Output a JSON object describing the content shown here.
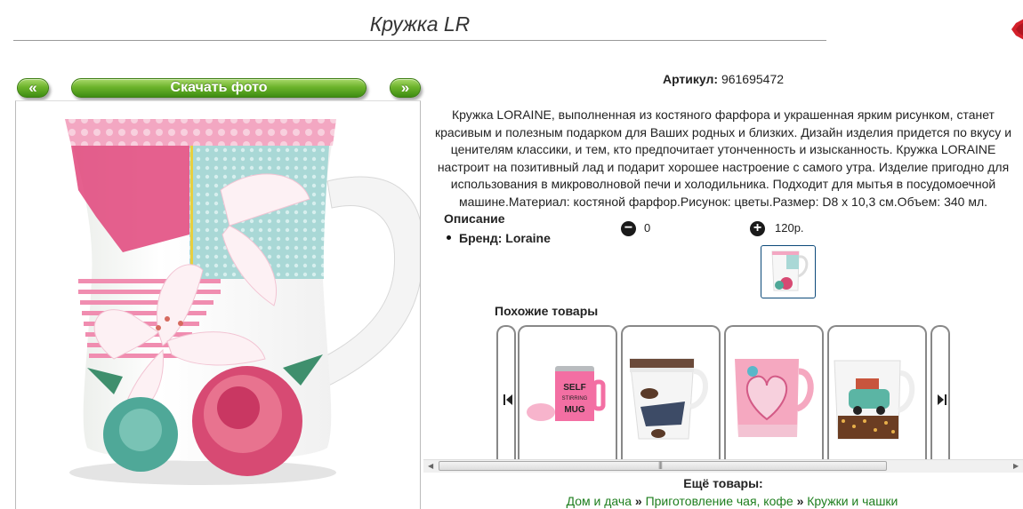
{
  "header": {
    "title": "Кружка LR"
  },
  "gallery": {
    "prev_label": "«",
    "download_label": "Скачать фото",
    "next_label": "»"
  },
  "product": {
    "article_label": "Артикул:",
    "article_value": "961695472",
    "description": "Кружка LORAINE, выполненная из костяного фарфора и украшенная ярким рисунком, станет красивым и полезным подарком для Ваших родных и близких. Дизайн изделия придется по вкусу и ценителям классики, и тем, кто предпочитает утонченность и изысканность. Кружка LORAINE настроит на позитивный лад и подарит хорошее настроение с самого утра. Изделие пригодно для использования в микроволновой печи и холодильника. Подходит для мытья в посудомоечной машине.Материал: костяной фарфор.Рисунок: цветы.Размер: D8 x 10,3 см.Объем: 340 мл.",
    "desc_heading": "Описание",
    "brand": "Бренд: Loraine",
    "minus_value": "0",
    "plus_value": "120р."
  },
  "similar": {
    "title": "Похожие товары",
    "items": [
      {
        "icon": "self-stirring-mug-image",
        "text": "SELF STIRRING MUG"
      },
      {
        "icon": "coffee-design-mug-image"
      },
      {
        "icon": "pink-heart-mug-image"
      },
      {
        "icon": "car-print-mug-image"
      }
    ]
  },
  "more": {
    "title": "Ещё товары:",
    "crumbs": [
      "Дом и дача",
      "Приготовление чая, кофе",
      "Кружки и чашки"
    ],
    "separator": "»"
  },
  "colors": {
    "button_green": "#6cb42b",
    "link_green": "#1e7e1e",
    "thumb_border": "#0d4a7a"
  }
}
